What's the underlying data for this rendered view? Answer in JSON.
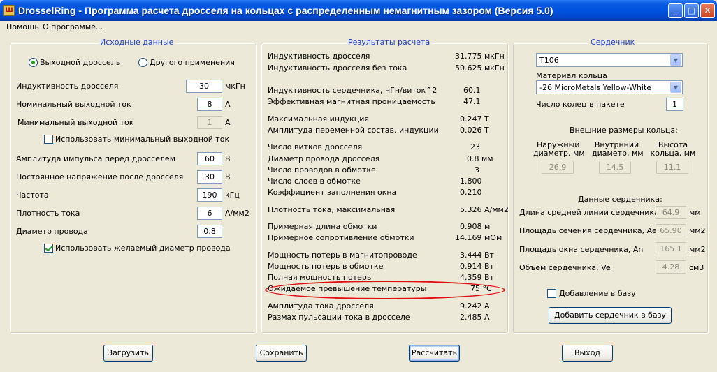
{
  "window": {
    "title": "DrosselRing - Программа расчета дросселя на кольцах с распределенным немагнитным зазором (Версия 5.0)",
    "icon_glyph": "Ш",
    "min_glyph": "_",
    "max_glyph": "□",
    "close_glyph": "✕"
  },
  "menu": {
    "help": "Помощь",
    "about": "О программе..."
  },
  "input_panel": {
    "title": "Исходные данные",
    "radio_output": "Выходной дроссель",
    "radio_other": "Другого применения",
    "fields": {
      "inductance": {
        "label": "Индуктивность  дросселя",
        "value": "30",
        "unit": "мкГн"
      },
      "nominal_current": {
        "label": "Номинальный выходной ток",
        "value": "8",
        "unit": "А"
      },
      "min_current": {
        "label": "Минимальный выходной ток",
        "value": "1",
        "unit": "А"
      },
      "use_min_current": "Использовать минимальный выходной ток",
      "pulse_amplitude": {
        "label": "Амплитуда импульса перед дросселем",
        "value": "60",
        "unit": "В"
      },
      "dc_voltage": {
        "label": "Постоянное напряжение после дросселя",
        "value": "30",
        "unit": "В"
      },
      "frequency": {
        "label": "Частота",
        "value": "190",
        "unit": "кГц"
      },
      "current_density": {
        "label": "Плотность тока",
        "value": "6",
        "unit": "А/мм2"
      },
      "wire_diameter": {
        "label": "Диаметр провода",
        "value": "0.8"
      },
      "use_wire_diameter": "Использовать желаемый диаметр провода"
    }
  },
  "results_panel": {
    "title": "Результаты расчета",
    "rows": [
      {
        "label": "Индуктивность дросселя",
        "value": "31.775 мкГн"
      },
      {
        "label": "Индуктивность дросселя без тока",
        "value": "50.625 мкГн"
      },
      {
        "label": "Индуктивность сердечника, нГн/виток^2",
        "value": "60.1"
      },
      {
        "label": "Эффективная магнитная проницаемость",
        "value": "47.1"
      },
      {
        "label": "Максимальная индукция",
        "value": "0.247 Т"
      },
      {
        "label": "Амплитуда переменной состав. индукции",
        "value": "0.026 Т"
      },
      {
        "label": "Число витков дросселя",
        "value": "23"
      },
      {
        "label": "Диаметр провода дросселя",
        "value": "0.8 мм"
      },
      {
        "label": "Число проводов в обмотке",
        "value": "3"
      },
      {
        "label": "Число слоев в обмотке",
        "value": "1.800"
      },
      {
        "label": "Коэффициент заполнения окна",
        "value": "0.210"
      },
      {
        "label": "Плотность тока, максимальная",
        "value": "5.326 А/мм2"
      },
      {
        "label": "Примерная длина обмотки",
        "value": "0.908 м"
      },
      {
        "label": "Примерное сопротивление обмотки",
        "value": "14.169 мОм"
      },
      {
        "label": "Мощность потерь в магнитопроводе",
        "value": "3.444 Вт"
      },
      {
        "label": "Мощность потерь в обмотке",
        "value": "0.914 Вт"
      },
      {
        "label": "Полная мощность потерь",
        "value": "4.359 Вт"
      },
      {
        "label": "Ожидаемое превышение температуры",
        "value": "75 °C"
      },
      {
        "label": "Амплитуда тока дросселя",
        "value": "9.242 А"
      },
      {
        "label": "Размах пульсации тока в дросселе",
        "value": "2.485 А"
      }
    ]
  },
  "core_panel": {
    "title": "Сердечник",
    "core_select": "T106",
    "material_label": "Материал кольца",
    "material_select": "-26 MicroMetals Yellow-White",
    "rings_label": "Число колец в пакете",
    "rings_value": "1",
    "dims_title": "Внешние размеры кольца:",
    "outer_label_1": "Наружный",
    "outer_label_2": "диаметр, мм",
    "inner_label_1": "Внутрнний",
    "inner_label_2": "диаметр, мм",
    "height_label_1": "Высота",
    "height_label_2": "кольца, мм",
    "outer_value": "26.9",
    "inner_value": "14.5",
    "height_value": "11.1",
    "core_data_title": "Данные сердечника:",
    "path_length": {
      "label": "Длина средней линии сердечника, le",
      "value": "64.9",
      "unit": "мм"
    },
    "cross_section": {
      "label": "Площадь сечения сердечника, Ae",
      "value": "65.90",
      "unit": "мм2"
    },
    "window_area": {
      "label": "Площадь окна сердечника, An",
      "value": "165.1",
      "unit": "мм2"
    },
    "volume": {
      "label": "Объем сердечника, Ve",
      "value": "4.28",
      "unit": "см3"
    },
    "add_to_db_check": "Добавление в базу",
    "add_core_button": "Добавить сердечник в базу"
  },
  "buttons": {
    "load": "Загрузить",
    "save": "Сохранить",
    "calculate": "Рассчитать",
    "exit": "Выход"
  },
  "colors": {
    "title_bar": "#0054e3",
    "panel_title": "#1e40c8",
    "highlight": "#e01010",
    "background": "#ece9d8"
  }
}
